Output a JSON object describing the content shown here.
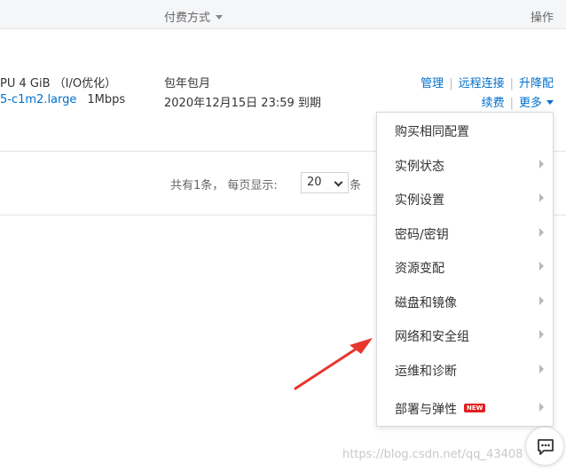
{
  "table": {
    "header": {
      "pay_method": "付费方式",
      "operations": "操作"
    },
    "row": {
      "spec_line1": "PU 4 GiB （I/O优化）",
      "spec_instance_type": "5-c1m2.large",
      "spec_bandwidth": "1Mbps",
      "pay_type": "包年包月",
      "expire_time": "2020年12月15日 23:59 到期",
      "actions": {
        "manage": "管理",
        "remote_connect": "远程连接",
        "upgrade": "升降配",
        "renew": "续费",
        "more": "更多"
      }
    }
  },
  "pager": {
    "total_text": "共有1条， 每页显示:",
    "page_size": "20",
    "unit": "条"
  },
  "more_menu": {
    "items": [
      {
        "label": "购买相同配置",
        "has_submenu": false
      },
      {
        "label": "实例状态",
        "has_submenu": true
      },
      {
        "label": "实例设置",
        "has_submenu": true
      },
      {
        "label": "密码/密钥",
        "has_submenu": true
      },
      {
        "label": "资源变配",
        "has_submenu": true
      },
      {
        "label": "磁盘和镜像",
        "has_submenu": true
      },
      {
        "label": "网络和安全组",
        "has_submenu": true
      },
      {
        "label": "运维和诊断",
        "has_submenu": true
      },
      {
        "label": "部署与弹性",
        "has_submenu": true,
        "badge": "NEW"
      }
    ]
  },
  "watermark": "https://blog.csdn.net/qq_43408",
  "colors": {
    "link": "#0070cc",
    "annotation_arrow": "#e8352e",
    "badge": "#e02020"
  }
}
